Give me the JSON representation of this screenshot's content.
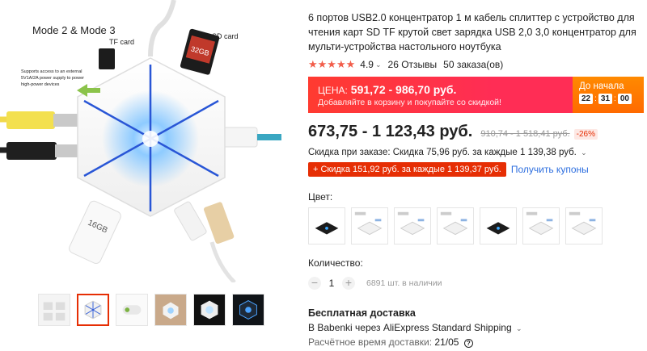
{
  "product": {
    "title": "6 портов USB2.0 концентратор 1 м кабель сплиттер с устройство для чтения карт SD TF крутой свет зарядка USB 2,0 3,0 концентратор для мульти-устройства настольного ноутбука",
    "rating": "4.9",
    "stars": "★★★★★",
    "reviews": "26 Отзывы",
    "orders": "50 заказа(ов)"
  },
  "image_text": {
    "mode_label": "Mode 2 & Mode 3",
    "tf_card": "TF card",
    "sd_card": "SD card",
    "support_note_1": "Supports access to an external",
    "support_note_2": "5V1A/2A power supply to power",
    "support_note_3": "high-power devices",
    "card_reader_label": "16GB",
    "sd_card_print": "32GB"
  },
  "sale": {
    "price_label": "ЦЕНА:",
    "price_range": "591,72 - 986,70 руб.",
    "subtitle": "Добавляйте в корзину и покупайте со скидкой!",
    "until_label": "До начала",
    "timer": [
      "22",
      "31",
      "00"
    ]
  },
  "pricing": {
    "current": "673,75 - 1 123,43 руб.",
    "old": "910,74 - 1 518,41 руб.",
    "discount": "-26%"
  },
  "promo": {
    "line": "Скидка при заказе: Скидка 75,96 руб. за каждые 1 139,38 руб.",
    "coupon_badge": "+ Скидка 151,92 руб. за каждые 1 139,37 руб.",
    "coupon_link": "Получить купоны"
  },
  "color": {
    "label": "Цвет:"
  },
  "quantity": {
    "label": "Количество:",
    "value": "1",
    "minus": "−",
    "plus": "+",
    "stock": "6891 шт. в наличии"
  },
  "shipping": {
    "title": "Бесплатная доставка",
    "line": "В Babenki через AliExpress Standard Shipping",
    "est_label": "Расчётное время доставки:",
    "est_date": "21/05",
    "help": "?"
  },
  "colors": {
    "accent_red": "#e62e04",
    "link_blue": "#2e6fdf",
    "star_red": "#f25d4a"
  }
}
